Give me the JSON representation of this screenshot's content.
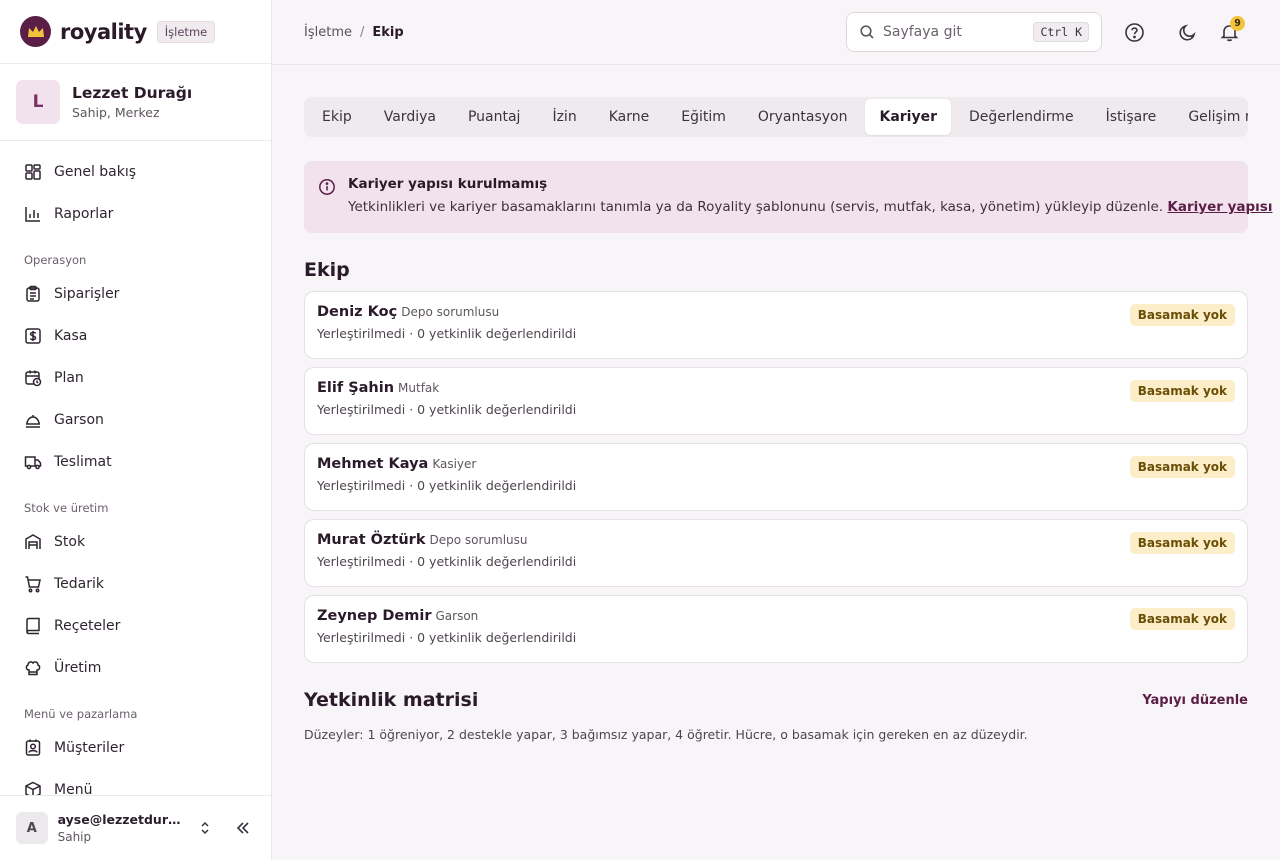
{
  "brand": {
    "name": "royality",
    "tag": "İşletme"
  },
  "org": {
    "initial": "L",
    "name": "Lezzet Durağı",
    "role": "Sahip, Merkez"
  },
  "sidebar": {
    "top": [
      {
        "label": "Genel bakış",
        "icon": "dashboard-icon"
      },
      {
        "label": "Raporlar",
        "icon": "bar-chart-icon"
      }
    ],
    "sections": [
      {
        "title": "Operasyon",
        "items": [
          {
            "label": "Siparişler",
            "icon": "clipboard-icon"
          },
          {
            "label": "Kasa",
            "icon": "cash-register-icon"
          },
          {
            "label": "Plan",
            "icon": "calendar-clock-icon"
          },
          {
            "label": "Garson",
            "icon": "service-bell-icon"
          },
          {
            "label": "Teslimat",
            "icon": "truck-icon"
          }
        ]
      },
      {
        "title": "Stok ve üretim",
        "items": [
          {
            "label": "Stok",
            "icon": "warehouse-icon"
          },
          {
            "label": "Tedarik",
            "icon": "cart-icon"
          },
          {
            "label": "Reçeteler",
            "icon": "book-icon"
          },
          {
            "label": "Üretim",
            "icon": "chef-hat-icon"
          }
        ]
      },
      {
        "title": "Menü ve pazarlama",
        "items": [
          {
            "label": "Müşteriler",
            "icon": "contact-icon"
          },
          {
            "label": "Menü",
            "icon": "package-icon"
          }
        ]
      }
    ]
  },
  "user": {
    "initial": "A",
    "email": "ayse@lezzetduragi.com",
    "role": "Sahip"
  },
  "breadcrumb": {
    "parent": "İşletme",
    "separator": "/",
    "current": "Ekip"
  },
  "search": {
    "placeholder": "Sayfaya git",
    "shortcut": "Ctrl K"
  },
  "notifications": {
    "count": "9"
  },
  "tabs": [
    "Ekip",
    "Vardiya",
    "Puantaj",
    "İzin",
    "Karne",
    "Eğitim",
    "Oryantasyon",
    "Kariyer",
    "Değerlendirme",
    "İstişare",
    "Gelişim raporu"
  ],
  "active_tab": "Kariyer",
  "alert": {
    "title": "Kariyer yapısı kurulmamış",
    "text": "Yetkinlikleri ve kariyer basamaklarını tanımla ya da Royality şablonunu (servis, mutfak, kasa, yönetim) yükleyip düzenle.",
    "link": "Kariyer yapısı"
  },
  "team": {
    "title": "Ekip",
    "members": [
      {
        "name": "Deniz Koç",
        "role": "Depo sorumlusu",
        "meta": "Yerleştirilmedi · 0 yetkinlik değerlendirildi",
        "badge": "Basamak yok"
      },
      {
        "name": "Elif Şahin",
        "role": "Mutfak",
        "meta": "Yerleştirilmedi · 0 yetkinlik değerlendirildi",
        "badge": "Basamak yok"
      },
      {
        "name": "Mehmet Kaya",
        "role": "Kasiyer",
        "meta": "Yerleştirilmedi · 0 yetkinlik değerlendirildi",
        "badge": "Basamak yok"
      },
      {
        "name": "Murat Öztürk",
        "role": "Depo sorumlusu",
        "meta": "Yerleştirilmedi · 0 yetkinlik değerlendirildi",
        "badge": "Basamak yok"
      },
      {
        "name": "Zeynep Demir",
        "role": "Garson",
        "meta": "Yerleştirilmedi · 0 yetkinlik değerlendirildi",
        "badge": "Basamak yok"
      }
    ]
  },
  "matrix": {
    "title": "Yetkinlik matrisi",
    "action": "Yapıyı düzenle",
    "note": "Düzeyler: 1 öğreniyor, 2 destekle yapar, 3 bağımsız yapar, 4 öğretir. Hücre, o basamak için gereken en az düzeydir."
  },
  "colors": {
    "accent": "#5b1f47",
    "alert_bg": "#f1e2ee",
    "badge_bg": "#fbeec9",
    "notification": "#f2c33c"
  }
}
